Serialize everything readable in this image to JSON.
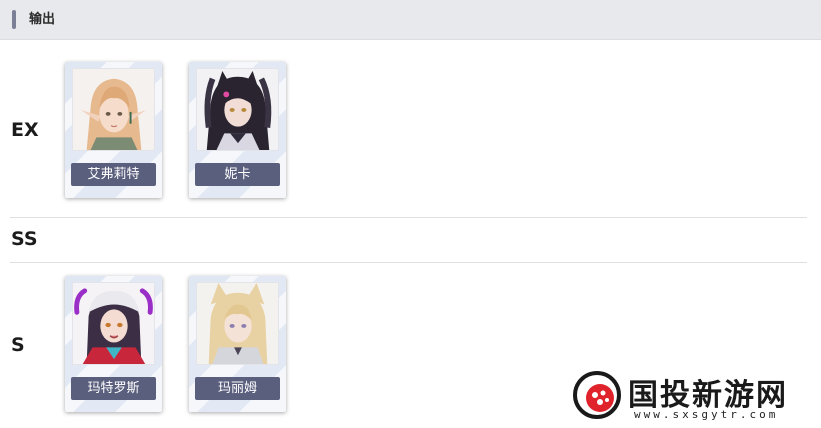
{
  "header": {
    "title": "输出"
  },
  "tiers": [
    {
      "label": "EX",
      "characters": [
        {
          "name": "艾弗莉特",
          "icon": "elf-portrait-icon"
        },
        {
          "name": "妮卡",
          "icon": "catgirl-dark-portrait-icon"
        }
      ]
    },
    {
      "label": "SS",
      "characters": []
    },
    {
      "label": "S",
      "characters": [
        {
          "name": "玛特罗斯",
          "icon": "cap-girl-portrait-icon"
        },
        {
          "name": "玛丽姆",
          "icon": "fox-girl-portrait-icon"
        }
      ]
    }
  ],
  "watermark": {
    "title": "国投新游网",
    "url": "www.sxsgytr.com"
  },
  "colors": {
    "header_bg": "#e8e9ec",
    "accent_bar": "#7b8096",
    "name_tag": "#5b5f7e"
  }
}
